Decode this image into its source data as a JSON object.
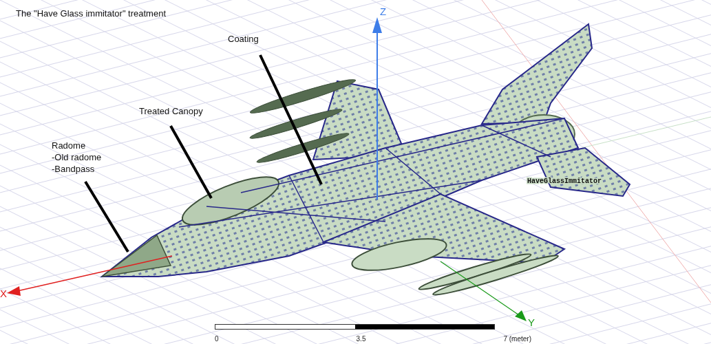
{
  "title": "The \"Have Glass immitator\" treatment",
  "callouts": [
    {
      "lines": [
        "Coating"
      ]
    },
    {
      "lines": [
        "Treated Canopy"
      ]
    },
    {
      "lines": [
        "Radome",
        "-Old radome",
        "-Bandpass"
      ]
    }
  ],
  "model_label": "HaveGlassImmitator",
  "axes": {
    "x": "X",
    "y": "Y",
    "z": "Z"
  },
  "scale_bar": {
    "ticks": [
      "0",
      "3.5",
      "7 (meter)"
    ]
  }
}
